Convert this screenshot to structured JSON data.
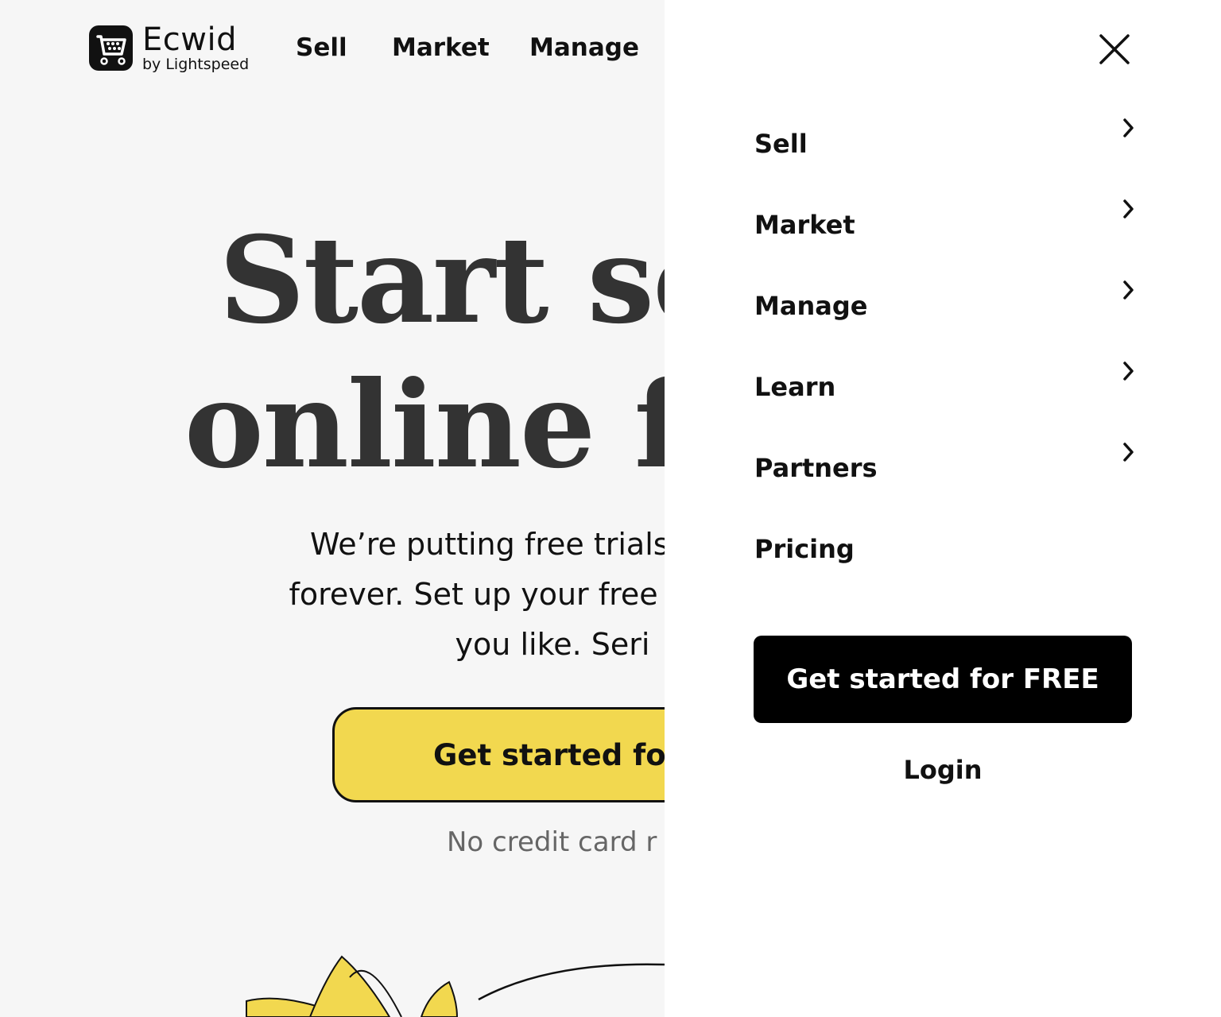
{
  "brand": {
    "name": "Ecwid",
    "sub": "by Lightspeed"
  },
  "topnav": {
    "items": [
      "Sell",
      "Market",
      "Manage"
    ]
  },
  "hero": {
    "title_line1": "Start se",
    "title_line2": "online fo",
    "desc_line1": "We’re putting free trials on trial.",
    "desc_line2": "forever. Set up your free account o",
    "desc_line3": "you like. Seri",
    "cta_label": "Get started fo",
    "note": "No credit card r"
  },
  "menu": {
    "items": [
      {
        "label": "Sell",
        "has_submenu": true
      },
      {
        "label": "Market",
        "has_submenu": true
      },
      {
        "label": "Manage",
        "has_submenu": true
      },
      {
        "label": "Learn",
        "has_submenu": true
      },
      {
        "label": "Partners",
        "has_submenu": true
      },
      {
        "label": "Pricing",
        "has_submenu": false
      }
    ],
    "cta_label": "Get started for FREE",
    "login_label": "Login"
  },
  "icons": {
    "close": "close-icon",
    "chevron": "chevron-right-icon",
    "logo": "cart-logo-icon"
  },
  "colors": {
    "accent_yellow": "#f2d84f",
    "cta_black": "#000000",
    "page_bg": "#f6f6f6",
    "drawer_bg": "#ffffff"
  }
}
